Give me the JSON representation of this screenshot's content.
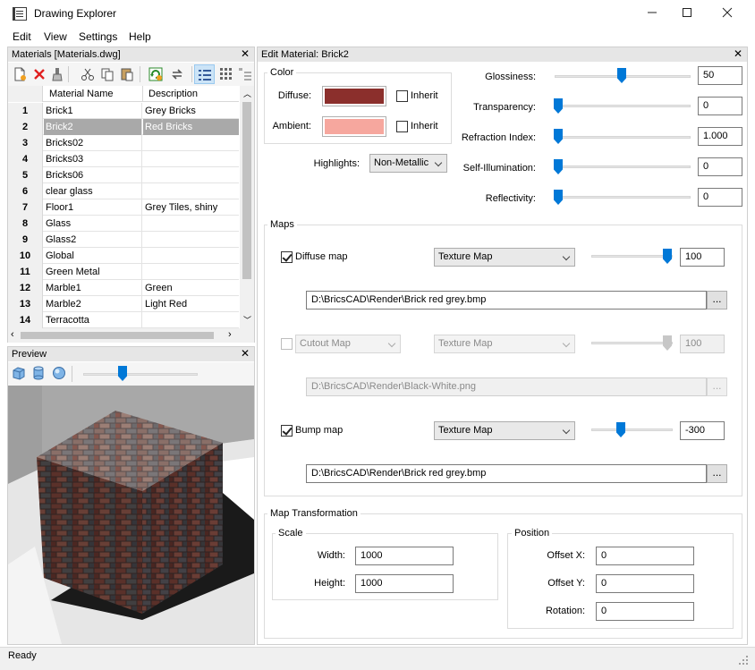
{
  "window": {
    "title": "Drawing Explorer"
  },
  "menu": [
    "Edit",
    "View",
    "Settings",
    "Help"
  ],
  "materials_panel": {
    "title": "Materials [Materials.dwg]",
    "columns": {
      "name": "Material Name",
      "description": "Description"
    },
    "rows": [
      {
        "num": "1",
        "name": "Brick1",
        "desc": "Grey Bricks"
      },
      {
        "num": "2",
        "name": "Brick2",
        "desc": "Red Bricks",
        "selected": true
      },
      {
        "num": "3",
        "name": "Bricks02",
        "desc": ""
      },
      {
        "num": "4",
        "name": "Bricks03",
        "desc": ""
      },
      {
        "num": "5",
        "name": "Bricks06",
        "desc": ""
      },
      {
        "num": "6",
        "name": "clear glass",
        "desc": ""
      },
      {
        "num": "7",
        "name": "Floor1",
        "desc": "Grey Tiles, shiny"
      },
      {
        "num": "8",
        "name": "Glass",
        "desc": ""
      },
      {
        "num": "9",
        "name": "Glass2",
        "desc": ""
      },
      {
        "num": "10",
        "name": "Global",
        "desc": ""
      },
      {
        "num": "11",
        "name": "Green Metal",
        "desc": ""
      },
      {
        "num": "12",
        "name": "Marble1",
        "desc": "Green"
      },
      {
        "num": "13",
        "name": "Marble2",
        "desc": "Light Red"
      },
      {
        "num": "14",
        "name": "Terracotta",
        "desc": ""
      }
    ]
  },
  "preview_panel": {
    "title": "Preview"
  },
  "edit_panel": {
    "title": "Edit Material: Brick2",
    "color": {
      "group_label": "Color",
      "diffuse_label": "Diffuse:",
      "diffuse_color": "#8b2f2c",
      "ambient_label": "Ambient:",
      "ambient_color": "#f6a79e",
      "inherit_label": "Inherit"
    },
    "highlights": {
      "label": "Highlights:",
      "value": "Non-Metallic"
    },
    "properties": [
      {
        "label": "Glossiness:",
        "value": "50"
      },
      {
        "label": "Transparency:",
        "value": "0"
      },
      {
        "label": "Refraction Index:",
        "value": "1.000"
      },
      {
        "label": "Self-Illumination:",
        "value": "0"
      },
      {
        "label": "Reflectivity:",
        "value": "0"
      }
    ],
    "maps": {
      "group_label": "Maps",
      "diffuse": {
        "label": "Diffuse map",
        "checked": true,
        "type": "Texture Map",
        "value": "100",
        "path": "D:\\BricsCAD\\Render\\Brick red grey.bmp"
      },
      "cutout": {
        "label": "Cutout Map",
        "checked": false,
        "type": "Texture Map",
        "value": "100",
        "path": "D:\\BricsCAD\\Render\\Black-White.png"
      },
      "bump": {
        "label": "Bump map",
        "checked": true,
        "type": "Texture Map",
        "value": "-300",
        "path": "D:\\BricsCAD\\Render\\Brick red grey.bmp"
      },
      "browse_label": "..."
    },
    "transform": {
      "group_label": "Map Transformation",
      "scale_label": "Scale",
      "width_label": "Width:",
      "width": "1000",
      "height_label": "Height:",
      "height": "1000",
      "position_label": "Position",
      "offset_x_label": "Offset X:",
      "offset_x": "0",
      "offset_y_label": "Offset Y:",
      "offset_y": "0",
      "rotation_label": "Rotation:",
      "rotation": "0"
    }
  },
  "status": {
    "text": "Ready"
  }
}
